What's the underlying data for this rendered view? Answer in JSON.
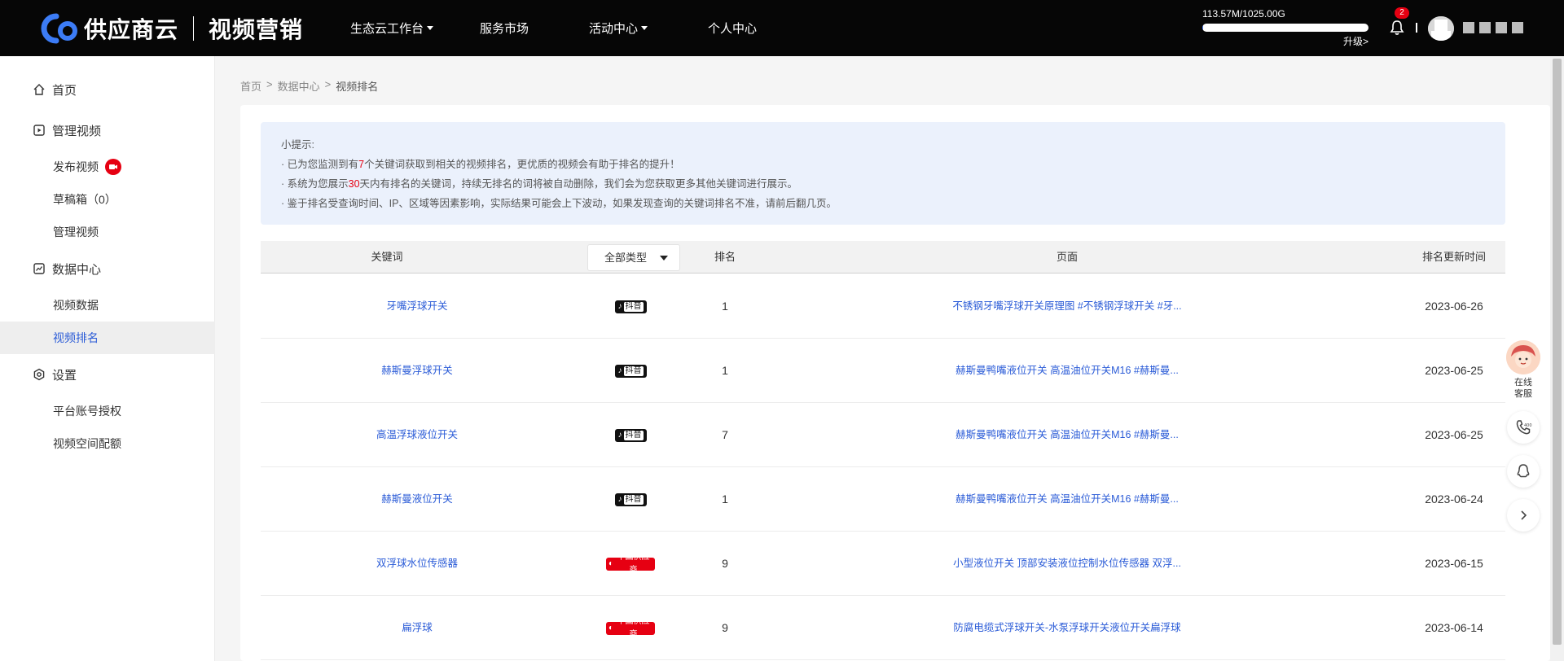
{
  "header": {
    "brand": "供应商云",
    "product": "视频营销",
    "nav": [
      {
        "label": "生态云工作台",
        "dropdown": true
      },
      {
        "label": "服务市场",
        "dropdown": false
      },
      {
        "label": "活动中心",
        "dropdown": true
      },
      {
        "label": "个人中心",
        "dropdown": false
      }
    ],
    "storage": {
      "text": "113.57M/1025.00G",
      "used_fraction": 0.00011
    },
    "upgrade_label": "升级>",
    "notification_count": "2"
  },
  "sidebar": {
    "groups": [
      {
        "label": "首页",
        "icon": "home-icon"
      },
      {
        "label": "管理视频",
        "icon": "video-icon"
      },
      {
        "label": "数据中心",
        "icon": "chart-icon"
      },
      {
        "label": "设置",
        "icon": "settings-icon"
      }
    ],
    "items": [
      {
        "label": "发布视频"
      },
      {
        "label": "草稿箱（0）"
      },
      {
        "label": "管理视频"
      },
      {
        "label": "视频数据"
      },
      {
        "label": "视频排名",
        "active": true
      },
      {
        "label": "平台账号授权"
      },
      {
        "label": "视频空间配额"
      }
    ]
  },
  "breadcrumb": {
    "home": "首页",
    "sep": ">",
    "section": "数据中心",
    "current": "视频排名"
  },
  "tips": {
    "title": "小提示:",
    "line1_pre": "· 已为您监测到有",
    "line1_num": "7",
    "line1_post": "个关键词获取到相关的视频排名，更优质的视频会有助于排名的提升！",
    "line2_pre": "· 系统为您展示",
    "line2_num": "30",
    "line2_post": "天内有排名的关键词，持续无排名的词将被自动删除，我们会为您获取更多其他关键词进行展示。",
    "line3": "· 鉴于排名受查询时间、IP、区域等因素影响，实际结果可能会上下波动，如果发现查询的关键词排名不准，请前后翻几页。"
  },
  "table": {
    "headers": {
      "keyword": "关键词",
      "type_filter": "全部类型",
      "rank": "排名",
      "page": "页面",
      "updated": "排名更新时间"
    },
    "rows": [
      {
        "keyword": "牙嘴浮球开关",
        "source": "抖音",
        "source_type": "douyin",
        "rank": "1",
        "page": "不锈钢牙嘴浮球开关原理图 #不锈钢浮球开关 #牙...",
        "date": "2023-06-26"
      },
      {
        "keyword": "赫斯曼浮球开关",
        "source": "抖音",
        "source_type": "douyin",
        "rank": "1",
        "page": "赫斯曼鸭嘴液位开关 高温油位开关M16 #赫斯曼...",
        "date": "2023-06-25"
      },
      {
        "keyword": "高温浮球液位开关",
        "source": "抖音",
        "source_type": "douyin",
        "rank": "7",
        "page": "赫斯曼鸭嘴液位开关 高温油位开关M16 #赫斯曼...",
        "date": "2023-06-25"
      },
      {
        "keyword": "赫斯曼液位开关",
        "source": "抖音",
        "source_type": "douyin",
        "rank": "1",
        "page": "赫斯曼鸭嘴液位开关 高温油位开关M16 #赫斯曼...",
        "date": "2023-06-24"
      },
      {
        "keyword": "双浮球水位传感器",
        "source": "中国供应商",
        "source_type": "china",
        "rank": "9",
        "page": "小型液位开关 顶部安装液位控制水位传感器 双浮...",
        "date": "2023-06-15"
      },
      {
        "keyword": "扁浮球",
        "source": "中国供应商",
        "source_type": "china",
        "rank": "9",
        "page": "防腐电缆式浮球开关-水泵浮球开关液位开关扁浮球",
        "date": "2023-06-14"
      }
    ]
  },
  "float_tools": {
    "service_label": "在线客服"
  },
  "colors": {
    "accent": "#2a5bd7",
    "alert": "#e60012",
    "topbar": "#060606",
    "tip_bg": "#ebf1fc"
  }
}
